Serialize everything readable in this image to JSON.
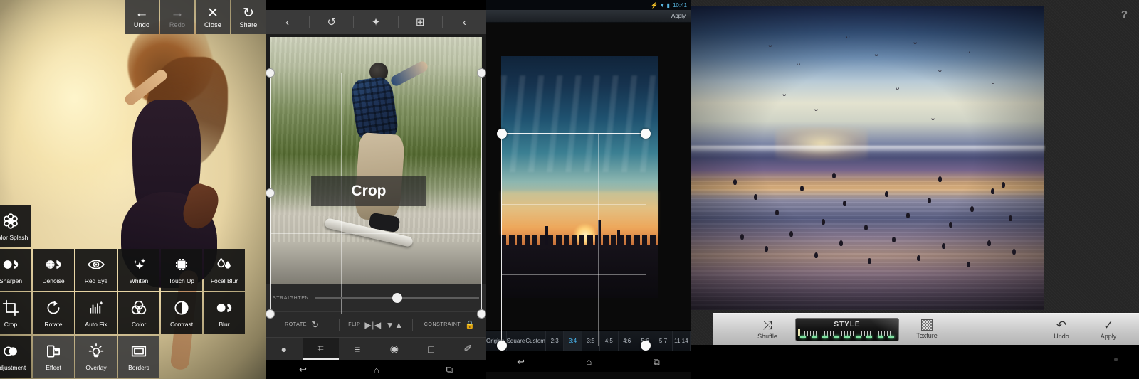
{
  "panel1": {
    "name": "photo-editor-tools",
    "topbar": [
      {
        "icon": "undo-arrow-icon",
        "glyph": "←",
        "label": "Undo",
        "disabled": false
      },
      {
        "icon": "redo-arrow-icon",
        "glyph": "→",
        "label": "Redo",
        "disabled": true
      },
      {
        "icon": "close-x-icon",
        "glyph": "✕",
        "label": "Close",
        "disabled": false
      },
      {
        "icon": "share-icon",
        "glyph": "↻",
        "label": "Share",
        "disabled": false
      }
    ],
    "rows": [
      [
        {
          "label": "Color Splash",
          "icon": "flower-splash-icon",
          "style": "dark"
        }
      ],
      [
        {
          "label": "Sharpen",
          "icon": "sharpen-icon",
          "style": "dark"
        },
        {
          "label": "Denoise",
          "icon": "denoise-icon",
          "style": "dark"
        },
        {
          "label": "Red Eye",
          "icon": "eye-icon",
          "style": "dark"
        },
        {
          "label": "Whiten",
          "icon": "sparkle-icon",
          "style": "dark"
        },
        {
          "label": "Touch Up",
          "icon": "touchup-icon",
          "style": "dark"
        },
        {
          "label": "Focal Blur",
          "icon": "droplets-icon",
          "style": "dark"
        }
      ],
      [
        {
          "label": "Crop",
          "icon": "crop-icon",
          "style": "dark"
        },
        {
          "label": "Rotate",
          "icon": "rotate-icon",
          "style": "dark"
        },
        {
          "label": "Auto Fix",
          "icon": "autofix-icon",
          "style": "dark"
        },
        {
          "label": "Color",
          "icon": "color-circles-icon",
          "style": "dark"
        },
        {
          "label": "Contrast",
          "icon": "contrast-icon",
          "style": "dark"
        },
        {
          "label": "Blur",
          "icon": "blur-icon",
          "style": "dark"
        }
      ],
      [
        {
          "label": "Adjustment",
          "icon": "adjustment-icon",
          "style": "dark"
        },
        {
          "label": "Effect",
          "icon": "film-roll-icon",
          "style": "grey"
        },
        {
          "label": "Overlay",
          "icon": "lightbulb-icon",
          "style": "grey"
        },
        {
          "label": "Borders",
          "icon": "border-frame-icon",
          "style": "grey"
        }
      ]
    ]
  },
  "panel2": {
    "name": "crop-editor",
    "topbar": [
      {
        "icon": "back-chevron-icon",
        "glyph": "‹"
      },
      {
        "icon": "undo-icon",
        "glyph": "↺"
      },
      {
        "icon": "magic-wand-icon",
        "glyph": "✦"
      },
      {
        "icon": "compare-icon",
        "glyph": "⊞"
      },
      {
        "icon": "share-icon",
        "glyph": "‹"
      }
    ],
    "overlay_label": "Crop",
    "straighten_label": "STRAIGHTEN",
    "rotate_label": "ROTATE",
    "flip_label": "FLIP",
    "constraint_label": "CONSTRAINT",
    "nav": [
      {
        "icon": "droplet-icon",
        "glyph": "●",
        "active": false
      },
      {
        "icon": "crop-icon",
        "glyph": "⌗",
        "active": true
      },
      {
        "icon": "sliders-icon",
        "glyph": "≡",
        "active": false
      },
      {
        "icon": "eye-icon",
        "glyph": "◉",
        "active": false
      },
      {
        "icon": "frame-icon",
        "glyph": "□",
        "active": false
      },
      {
        "icon": "brush-icon",
        "glyph": "✐",
        "active": false
      }
    ],
    "system_nav": [
      {
        "icon": "android-back-icon",
        "glyph": "↩"
      },
      {
        "icon": "android-home-icon",
        "glyph": "⌂"
      },
      {
        "icon": "android-recents-icon",
        "glyph": "⧉"
      }
    ]
  },
  "panel3": {
    "name": "crop-ratio-editor",
    "status_time": "10:41",
    "status_icons": "⚡ ▼ ▮",
    "apply_label": "Apply",
    "ratios": [
      {
        "label": "Original",
        "selected": false
      },
      {
        "label": "Square",
        "selected": false
      },
      {
        "label": "Custom",
        "selected": false
      },
      {
        "label": "2:3",
        "selected": false
      },
      {
        "label": "3:4",
        "selected": true
      },
      {
        "label": "3:5",
        "selected": false
      },
      {
        "label": "4:5",
        "selected": false
      },
      {
        "label": "4:6",
        "selected": false
      },
      {
        "label": "5:6",
        "selected": false
      },
      {
        "label": "5:7",
        "selected": false
      },
      {
        "label": "11:14",
        "selected": false
      }
    ],
    "system_nav": [
      {
        "icon": "android-back-icon",
        "glyph": "↩"
      },
      {
        "icon": "android-home-icon",
        "glyph": "⌂"
      },
      {
        "icon": "android-recents-icon",
        "glyph": "⧉"
      }
    ]
  },
  "panel4": {
    "name": "style-texture-editor",
    "help_label": "?",
    "shuffle": {
      "label": "Shuffle",
      "icon": "shuffle-icon",
      "glyph": "⤨"
    },
    "style": {
      "label": "STYLE",
      "led_count": 9,
      "led_color": "#7fe0a0"
    },
    "texture": {
      "label": "Texture",
      "icon": "texture-swatch-icon"
    },
    "undo": {
      "label": "Undo",
      "icon": "undo-icon",
      "glyph": "↶"
    },
    "apply": {
      "label": "Apply",
      "icon": "checkmark-icon",
      "glyph": "✓"
    }
  }
}
